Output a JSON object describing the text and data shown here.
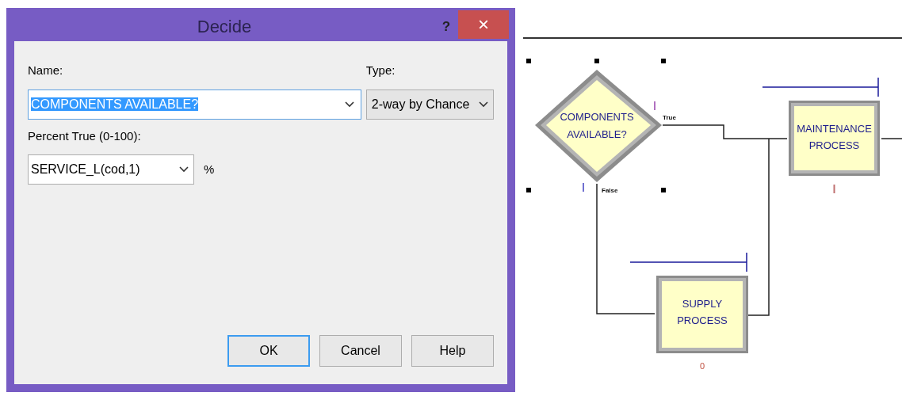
{
  "dialog": {
    "title": "Decide",
    "help": "?",
    "close": "×",
    "name": {
      "label": "Name:",
      "value": "COMPONENTS AVAILABLE?",
      "text_selected": true
    },
    "type": {
      "label": "Type:",
      "value": "2-way by Chance"
    },
    "percent": {
      "label": "Percent True (0-100):",
      "value": "SERVICE_L(cod,1)",
      "unit": "%"
    },
    "buttons": [
      {
        "label": "OK",
        "default": true
      },
      {
        "label": "Cancel",
        "default": false
      },
      {
        "label": "Help",
        "default": false
      }
    ]
  },
  "diagram": {
    "nodes": [
      {
        "kind": "decide",
        "lines": [
          "COMPONENTS",
          "AVAILABLE?"
        ],
        "selected": true,
        "branch_labels": [
          "True",
          "False"
        ]
      },
      {
        "kind": "process",
        "lines": [
          "MAINTENANCE",
          "PROCESS"
        ]
      },
      {
        "kind": "process",
        "lines": [
          "SUPPLY",
          "PROCESS"
        ],
        "counter": "0"
      }
    ]
  }
}
